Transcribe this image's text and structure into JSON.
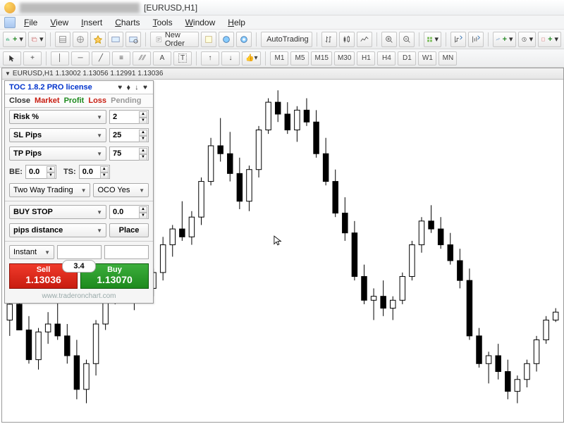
{
  "window": {
    "title": "[EURUSD,H1]"
  },
  "menu": {
    "file": "File",
    "view": "View",
    "insert": "Insert",
    "charts": "Charts",
    "tools": "Tools",
    "window": "Window",
    "help": "Help"
  },
  "toolbar": {
    "newOrder": "New Order",
    "autoTrading": "AutoTrading"
  },
  "timeframes": {
    "m1": "M1",
    "m5": "M5",
    "m15": "M15",
    "m30": "M30",
    "h1": "H1",
    "h4": "H4",
    "d1": "D1",
    "w1": "W1",
    "mn": "MN"
  },
  "chart": {
    "header": "EURUSD,H1  1.13002 1.13056 1.12991 1.13036"
  },
  "panel": {
    "title": "TOC 1.8.2 PRO license",
    "tabs": {
      "close": "Close",
      "market": "Market",
      "profit": "Profit",
      "loss": "Loss",
      "pending": "Pending"
    },
    "colors": {
      "close": "#333",
      "market": "#c81c10",
      "profit": "#1d8a1d",
      "loss": "#c81c10",
      "pending": "#999"
    },
    "risk": {
      "label": "Risk %",
      "value": "2"
    },
    "sl": {
      "label": "SL Pips",
      "value": "25"
    },
    "tp": {
      "label": "TP Pips",
      "value": "75"
    },
    "be": {
      "label": "BE:",
      "value": "0.0"
    },
    "ts": {
      "label": "TS:",
      "value": "0.0"
    },
    "mode": "Two Way Trading",
    "oco": "OCO Yes",
    "orderType": "BUY STOP",
    "orderPrice": "0.0",
    "distance": "pips distance",
    "place": "Place",
    "instant": "Instant",
    "spread": "3.4",
    "sell": {
      "label": "Sell",
      "price": "1.13036"
    },
    "buy": {
      "label": "Buy",
      "price": "1.13070"
    },
    "footer": "www.traderonchart.com"
  },
  "chart_data": {
    "type": "candlestick",
    "symbol": "EURUSD",
    "timeframe": "H1",
    "ohlc_last": {
      "open": 1.13002,
      "high": 1.13056,
      "low": 1.12991,
      "close": 1.13036
    },
    "candles": [
      {
        "o": 1.13,
        "h": 1.1315,
        "l": 1.1292,
        "c": 1.1308
      },
      {
        "o": 1.1308,
        "h": 1.132,
        "l": 1.1298,
        "c": 1.1295
      },
      {
        "o": 1.1295,
        "h": 1.1302,
        "l": 1.1278,
        "c": 1.128
      },
      {
        "o": 1.128,
        "h": 1.1296,
        "l": 1.1275,
        "c": 1.1294
      },
      {
        "o": 1.1294,
        "h": 1.1304,
        "l": 1.1288,
        "c": 1.1298
      },
      {
        "o": 1.1298,
        "h": 1.131,
        "l": 1.129,
        "c": 1.1292
      },
      {
        "o": 1.1292,
        "h": 1.1298,
        "l": 1.1278,
        "c": 1.1282
      },
      {
        "o": 1.1282,
        "h": 1.129,
        "l": 1.126,
        "c": 1.1265
      },
      {
        "o": 1.1265,
        "h": 1.128,
        "l": 1.1258,
        "c": 1.1278
      },
      {
        "o": 1.1278,
        "h": 1.13,
        "l": 1.1272,
        "c": 1.1298
      },
      {
        "o": 1.1298,
        "h": 1.1318,
        "l": 1.1295,
        "c": 1.1315
      },
      {
        "o": 1.1315,
        "h": 1.1325,
        "l": 1.1308,
        "c": 1.132
      },
      {
        "o": 1.132,
        "h": 1.1326,
        "l": 1.131,
        "c": 1.1312
      },
      {
        "o": 1.1312,
        "h": 1.1322,
        "l": 1.1305,
        "c": 1.132
      },
      {
        "o": 1.132,
        "h": 1.133,
        "l": 1.1314,
        "c": 1.1316
      },
      {
        "o": 1.1316,
        "h": 1.1326,
        "l": 1.1312,
        "c": 1.1324
      },
      {
        "o": 1.1324,
        "h": 1.1342,
        "l": 1.132,
        "c": 1.1338
      },
      {
        "o": 1.1338,
        "h": 1.1348,
        "l": 1.1332,
        "c": 1.1346
      },
      {
        "o": 1.1346,
        "h": 1.136,
        "l": 1.134,
        "c": 1.1342
      },
      {
        "o": 1.1342,
        "h": 1.1355,
        "l": 1.1338,
        "c": 1.1352
      },
      {
        "o": 1.1352,
        "h": 1.1372,
        "l": 1.1348,
        "c": 1.137
      },
      {
        "o": 1.137,
        "h": 1.1392,
        "l": 1.1368,
        "c": 1.1388
      },
      {
        "o": 1.1388,
        "h": 1.1402,
        "l": 1.138,
        "c": 1.1384
      },
      {
        "o": 1.1384,
        "h": 1.1395,
        "l": 1.137,
        "c": 1.1374
      },
      {
        "o": 1.1374,
        "h": 1.1382,
        "l": 1.1356,
        "c": 1.136
      },
      {
        "o": 1.136,
        "h": 1.1378,
        "l": 1.1355,
        "c": 1.1376
      },
      {
        "o": 1.1376,
        "h": 1.1398,
        "l": 1.1372,
        "c": 1.1396
      },
      {
        "o": 1.1396,
        "h": 1.1412,
        "l": 1.1394,
        "c": 1.141
      },
      {
        "o": 1.141,
        "h": 1.1416,
        "l": 1.14,
        "c": 1.1404
      },
      {
        "o": 1.1404,
        "h": 1.141,
        "l": 1.1394,
        "c": 1.1396
      },
      {
        "o": 1.1396,
        "h": 1.1408,
        "l": 1.139,
        "c": 1.1406
      },
      {
        "o": 1.1406,
        "h": 1.1412,
        "l": 1.1398,
        "c": 1.14
      },
      {
        "o": 1.14,
        "h": 1.1406,
        "l": 1.1382,
        "c": 1.1384
      },
      {
        "o": 1.1384,
        "h": 1.1392,
        "l": 1.1368,
        "c": 1.137
      },
      {
        "o": 1.137,
        "h": 1.1376,
        "l": 1.1352,
        "c": 1.1354
      },
      {
        "o": 1.1354,
        "h": 1.1362,
        "l": 1.134,
        "c": 1.1344
      },
      {
        "o": 1.1344,
        "h": 1.135,
        "l": 1.132,
        "c": 1.1322
      },
      {
        "o": 1.1322,
        "h": 1.1328,
        "l": 1.1308,
        "c": 1.131
      },
      {
        "o": 1.131,
        "h": 1.1316,
        "l": 1.13,
        "c": 1.1312
      },
      {
        "o": 1.1312,
        "h": 1.132,
        "l": 1.1302,
        "c": 1.1306
      },
      {
        "o": 1.1306,
        "h": 1.1312,
        "l": 1.13,
        "c": 1.131
      },
      {
        "o": 1.131,
        "h": 1.1324,
        "l": 1.1308,
        "c": 1.1322
      },
      {
        "o": 1.1322,
        "h": 1.134,
        "l": 1.132,
        "c": 1.1338
      },
      {
        "o": 1.1338,
        "h": 1.1352,
        "l": 1.1334,
        "c": 1.135
      },
      {
        "o": 1.135,
        "h": 1.1358,
        "l": 1.1344,
        "c": 1.1346
      },
      {
        "o": 1.1346,
        "h": 1.1352,
        "l": 1.1336,
        "c": 1.1338
      },
      {
        "o": 1.1338,
        "h": 1.1344,
        "l": 1.1328,
        "c": 1.133
      },
      {
        "o": 1.133,
        "h": 1.1336,
        "l": 1.1316,
        "c": 1.132
      },
      {
        "o": 1.132,
        "h": 1.1326,
        "l": 1.129,
        "c": 1.1292
      },
      {
        "o": 1.1292,
        "h": 1.1296,
        "l": 1.1276,
        "c": 1.1278
      },
      {
        "o": 1.1278,
        "h": 1.1284,
        "l": 1.1268,
        "c": 1.1282
      },
      {
        "o": 1.1282,
        "h": 1.1288,
        "l": 1.127,
        "c": 1.1274
      },
      {
        "o": 1.1274,
        "h": 1.128,
        "l": 1.126,
        "c": 1.1264
      },
      {
        "o": 1.1264,
        "h": 1.1272,
        "l": 1.1258,
        "c": 1.127
      },
      {
        "o": 1.127,
        "h": 1.128,
        "l": 1.1266,
        "c": 1.1278
      },
      {
        "o": 1.1278,
        "h": 1.1292,
        "l": 1.1274,
        "c": 1.129
      },
      {
        "o": 1.129,
        "h": 1.1302,
        "l": 1.1288,
        "c": 1.13
      },
      {
        "o": 1.13,
        "h": 1.1306,
        "l": 1.1299,
        "c": 1.1304
      }
    ],
    "ylim": [
      1.125,
      1.142
    ]
  }
}
